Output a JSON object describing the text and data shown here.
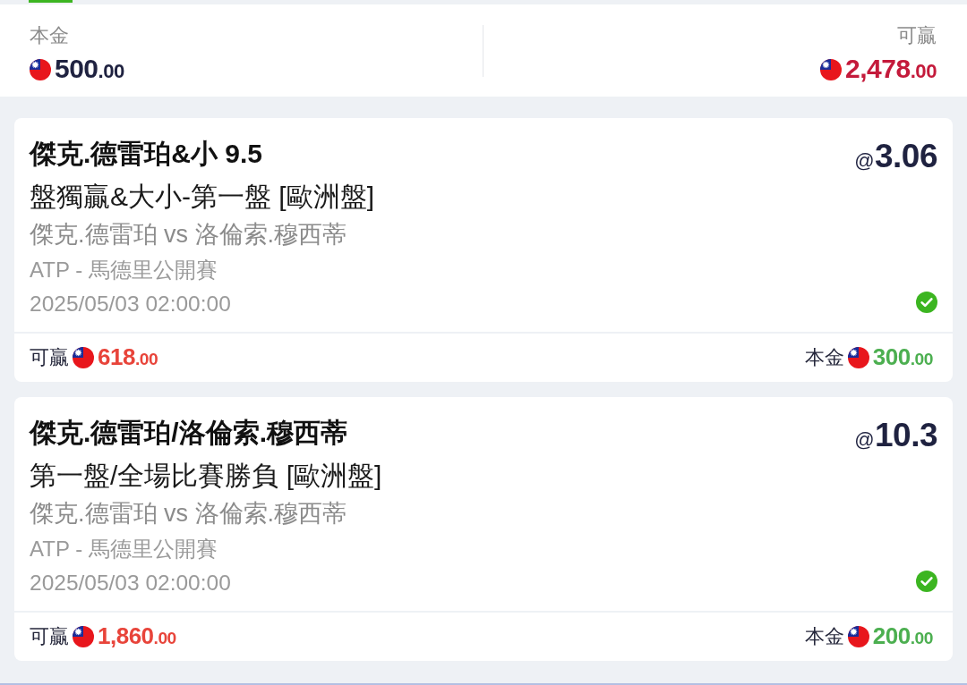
{
  "summary": {
    "stake": {
      "label": "本金",
      "amount": "500.00"
    },
    "potential_win": {
      "label": "可贏",
      "amount": "2,478.00"
    }
  },
  "bets": [
    {
      "title": "傑克.德雷珀&小 9.5",
      "market": "盤獨贏&大小-第一盤 [歐洲盤]",
      "match": "傑克.德雷珀 vs 洛倫索.穆西蒂",
      "league": "ATP - 馬德里公開賽",
      "time": "2025/05/03 02:00:00",
      "odds": "@3.06",
      "won": true,
      "potential_win": {
        "label": "可贏",
        "amount": "618.00"
      },
      "stake": {
        "label": "本金",
        "amount": "300.00"
      }
    },
    {
      "title": "傑克.德雷珀/洛倫索.穆西蒂",
      "market": "第一盤/全場比賽勝負 [歐洲盤]",
      "match": "傑克.德雷珀 vs 洛倫索.穆西蒂",
      "league": "ATP - 馬德里公開賽",
      "time": "2025/05/03 02:00:00",
      "odds": "@10.3",
      "won": true,
      "potential_win": {
        "label": "可贏",
        "amount": "1,860.00"
      },
      "stake": {
        "label": "本金",
        "amount": "200.00"
      }
    }
  ]
}
